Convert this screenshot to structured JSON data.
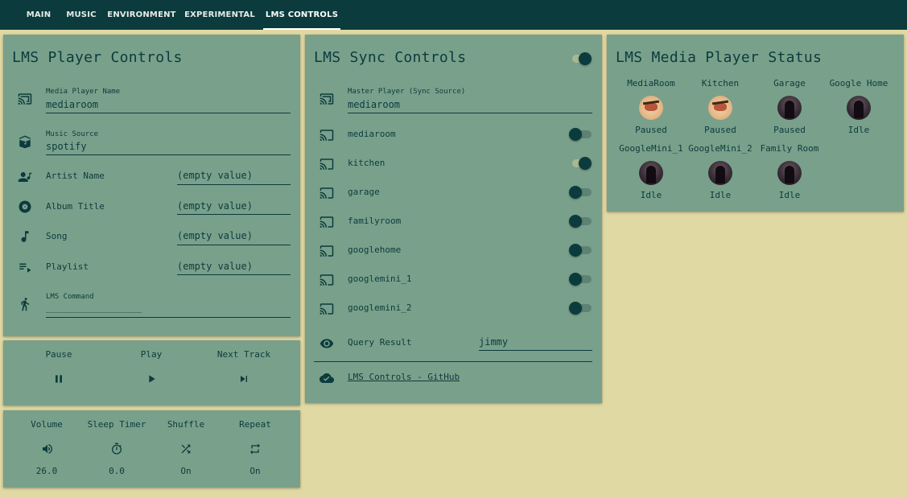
{
  "tabs": [
    {
      "label": "MAIN"
    },
    {
      "label": "MUSIC"
    },
    {
      "label": "ENVIRONMENT"
    },
    {
      "label": "EXPERIMENTAL"
    },
    {
      "label": "LMS CONTROLS",
      "active": true
    }
  ],
  "player_controls": {
    "title": "LMS Player Controls",
    "media_player_name": {
      "label": "Media Player Name",
      "value": "mediaroom",
      "icon": "cast-icon"
    },
    "music_source": {
      "label": "Music Source",
      "value": "spotify",
      "icon": "book-music-icon"
    },
    "artist": {
      "label": "Artist Name",
      "value": "(empty value)",
      "icon": "artist-icon"
    },
    "album": {
      "label": "Album Title",
      "value": "(empty value)",
      "icon": "disc-icon"
    },
    "song": {
      "label": "Song",
      "value": "(empty value)",
      "icon": "music-note-icon"
    },
    "playlist": {
      "label": "Playlist",
      "value": "(empty value)",
      "icon": "playlist-icon"
    },
    "command": {
      "label": "LMS Command",
      "value": "__________________",
      "icon": "run-icon"
    }
  },
  "transport": {
    "pause": "Pause",
    "play": "Play",
    "next": "Next Track"
  },
  "settings": {
    "volume": {
      "label": "Volume",
      "value": "26.0"
    },
    "sleep": {
      "label": "Sleep Timer",
      "value": "0.0"
    },
    "shuffle": {
      "label": "Shuffle",
      "value": "On"
    },
    "repeat": {
      "label": "Repeat",
      "value": "On"
    }
  },
  "sync": {
    "title": "LMS Sync Controls",
    "master_toggle_on": true,
    "master": {
      "label": "Master Player (Sync Source)",
      "value": "mediaroom"
    },
    "players": [
      {
        "name": "mediaroom",
        "on": false
      },
      {
        "name": "kitchen",
        "on": true
      },
      {
        "name": "garage",
        "on": false
      },
      {
        "name": "familyroom",
        "on": false
      },
      {
        "name": "googlehome",
        "on": false
      },
      {
        "name": "googlemini_1",
        "on": false
      },
      {
        "name": "googlemini_2",
        "on": false
      }
    ],
    "query": {
      "label": "Query Result",
      "value": "jimmy"
    },
    "github_link": "LMS Controls - GitHub"
  },
  "status": {
    "title": "LMS Media Player Status",
    "players": [
      {
        "name": "MediaRoom",
        "state": "Paused",
        "art": "art"
      },
      {
        "name": "Kitchen",
        "state": "Paused",
        "art": "art"
      },
      {
        "name": "Garage",
        "state": "Paused",
        "art": "dark"
      },
      {
        "name": "Google Home",
        "state": "Idle",
        "art": "dark"
      },
      {
        "name": "GoogleMini_1",
        "state": "Idle",
        "art": "dark"
      },
      {
        "name": "GoogleMini_2",
        "state": "Idle",
        "art": "dark"
      },
      {
        "name": "Family Room",
        "state": "Idle",
        "art": "dark"
      }
    ]
  },
  "colors": {
    "background": "#e1d9a3",
    "topbar": "#0b3b3c",
    "card": "#79a08b",
    "accent": "#0b3b3c"
  }
}
